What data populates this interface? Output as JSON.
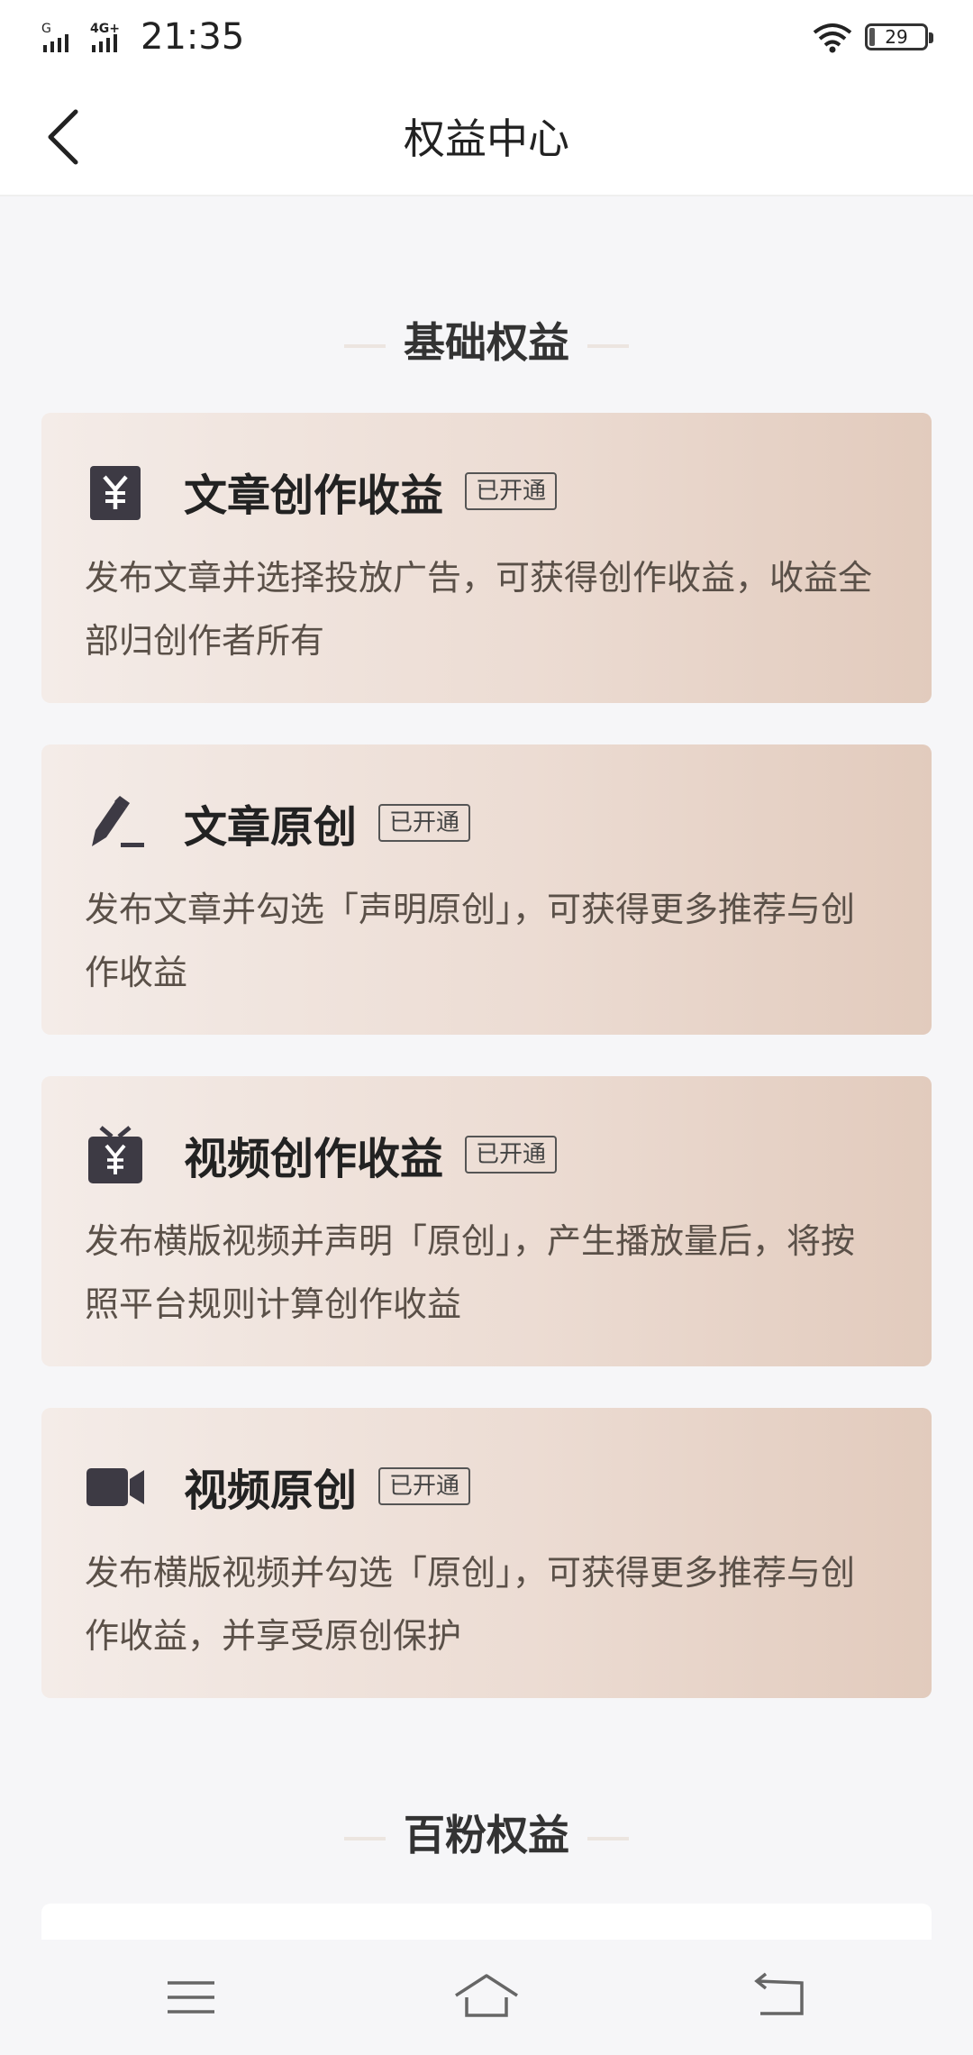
{
  "status_bar": {
    "time": "21:35",
    "battery": "29",
    "signal_1": "G",
    "signal_2": "4G+"
  },
  "header": {
    "title": "权益中心"
  },
  "sections": [
    {
      "title": "基础权益",
      "cards": [
        {
          "icon": "yen-document-icon",
          "title": "文章创作收益",
          "badge": "已开通",
          "description": "发布文章并选择投放广告，可获得创作收益，收益全部归创作者所有"
        },
        {
          "icon": "pen-icon",
          "title": "文章原创",
          "badge": "已开通",
          "description": "发布文章并勾选「声明原创」，可获得更多推荐与创作收益"
        },
        {
          "icon": "tv-yen-icon",
          "title": "视频创作收益",
          "badge": "已开通",
          "description": "发布横版视频并声明「原创」，产生播放量后，将按照平台规则计算创作收益"
        },
        {
          "icon": "video-camera-icon",
          "title": "视频原创",
          "badge": "已开通",
          "description": "发布横版视频并勾选「原创」，可获得更多推荐与创作收益，并享受原创保护"
        }
      ]
    },
    {
      "title": "百粉权益"
    }
  ],
  "system_nav": {
    "icons": [
      "menu-icon",
      "home-icon",
      "back-icon"
    ]
  },
  "colors": {
    "background": "#f6f6f8",
    "card_gradient_start": "#f4ece8",
    "card_gradient_end": "#e2cbbd",
    "icon": "#3d3a44"
  }
}
